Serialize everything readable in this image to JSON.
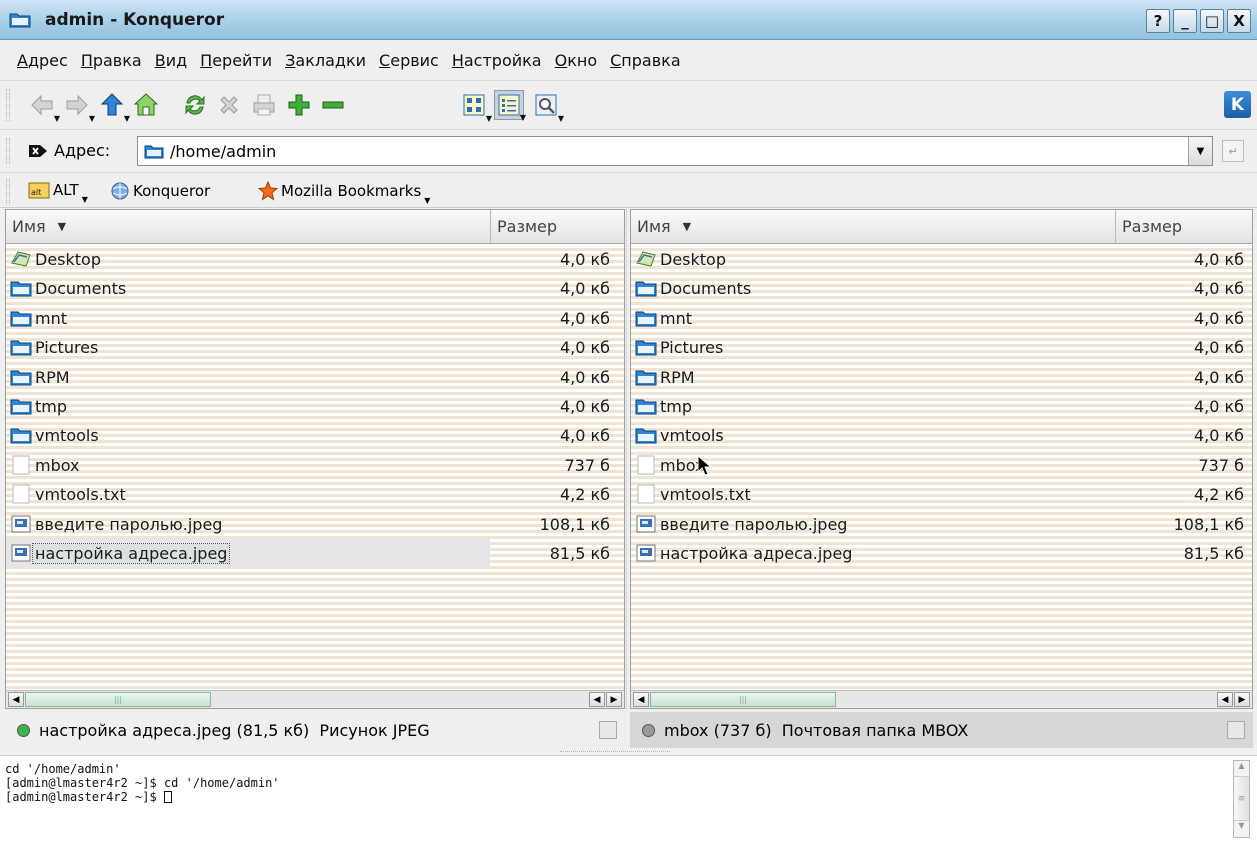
{
  "window": {
    "title": "admin - Konqueror",
    "buttons": [
      "?",
      "_",
      "□",
      "X"
    ]
  },
  "menu": [
    "Адрес",
    "Правка",
    "Вид",
    "Перейти",
    "Закладки",
    "Сервис",
    "Настройка",
    "Окно",
    "Справка"
  ],
  "toolbar": {
    "icons": [
      "back-icon",
      "forward-icon",
      "up-icon",
      "home-icon",
      "reload-icon",
      "stop-icon",
      "print-icon",
      "zoom-in-icon",
      "zoom-out-icon",
      "icon-view-icon",
      "detailed-view-icon",
      "find-icon"
    ],
    "logo": "K"
  },
  "location": {
    "label": "Адрес:",
    "value": "/home/admin"
  },
  "bookmarks": [
    "ALT",
    "Konqueror",
    "Mozilla Bookmarks"
  ],
  "columns": {
    "name": "Имя",
    "size": "Размер"
  },
  "left_pane": {
    "files": [
      {
        "name": "Desktop",
        "size": "4,0 кб",
        "icon": "desktop-icon"
      },
      {
        "name": "Documents",
        "size": "4,0 кб",
        "icon": "folder-icon"
      },
      {
        "name": "mnt",
        "size": "4,0 кб",
        "icon": "folder-icon"
      },
      {
        "name": "Pictures",
        "size": "4,0 кб",
        "icon": "folder-icon"
      },
      {
        "name": "RPM",
        "size": "4,0 кб",
        "icon": "folder-icon"
      },
      {
        "name": "tmp",
        "size": "4,0 кб",
        "icon": "folder-icon"
      },
      {
        "name": "vmtools",
        "size": "4,0 кб",
        "icon": "folder-icon"
      },
      {
        "name": "mbox",
        "size": "737 б",
        "icon": "file-icon"
      },
      {
        "name": "vmtools.txt",
        "size": "4,2 кб",
        "icon": "file-icon"
      },
      {
        "name": "введите паролью.jpeg",
        "size": "108,1 кб",
        "icon": "image-icon"
      },
      {
        "name": "настройка адреса.jpeg",
        "size": "81,5 кб",
        "icon": "image-icon",
        "selected": true
      }
    ],
    "status": "настройка адреса.jpeg (81,5 кб)  Рисунок JPEG",
    "status_color": "#3cb34c"
  },
  "right_pane": {
    "files": [
      {
        "name": "Desktop",
        "size": "4,0 кб",
        "icon": "desktop-icon"
      },
      {
        "name": "Documents",
        "size": "4,0 кб",
        "icon": "folder-icon"
      },
      {
        "name": "mnt",
        "size": "4,0 кб",
        "icon": "folder-icon"
      },
      {
        "name": "Pictures",
        "size": "4,0 кб",
        "icon": "folder-icon"
      },
      {
        "name": "RPM",
        "size": "4,0 кб",
        "icon": "folder-icon"
      },
      {
        "name": "tmp",
        "size": "4,0 кб",
        "icon": "folder-icon"
      },
      {
        "name": "vmtools",
        "size": "4,0 кб",
        "icon": "folder-icon"
      },
      {
        "name": "mbox",
        "size": "737 б",
        "icon": "file-icon"
      },
      {
        "name": "vmtools.txt",
        "size": "4,2 кб",
        "icon": "file-icon"
      },
      {
        "name": "введите паролью.jpeg",
        "size": "108,1 кб",
        "icon": "image-icon"
      },
      {
        "name": "настройка адреса.jpeg",
        "size": "81,5 кб",
        "icon": "image-icon"
      }
    ],
    "status": "mbox (737 б)  Почтовая папка MBOX",
    "status_color": "#9a9a9a"
  },
  "terminal": {
    "lines": [
      "cd '/home/admin'",
      "[admin@lmaster4r2 ~]$ cd '/home/admin'",
      "[admin@lmaster4r2 ~]$ "
    ]
  },
  "colors": {
    "titlebar": "#a6cfe8",
    "stripe": "#efe4d3",
    "folder": "#2f86d6"
  }
}
